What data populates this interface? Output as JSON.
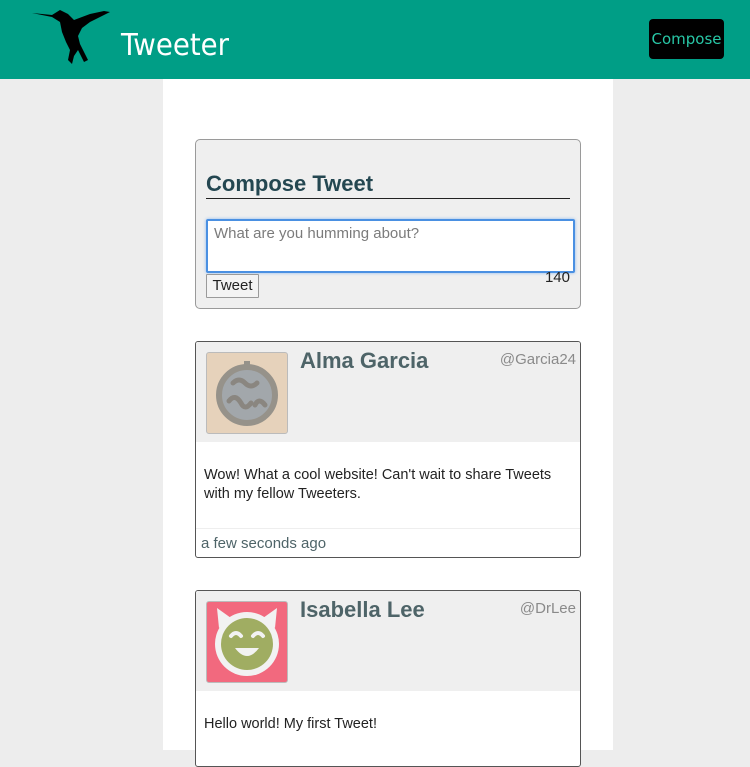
{
  "navbar": {
    "logo_icon": "hummingbird-icon",
    "brand": "Tweeter",
    "compose_button": "Compose",
    "colors": {
      "background": "#009e86",
      "compose_text": "#28c7a6"
    }
  },
  "composer": {
    "title": "Compose Tweet",
    "placeholder": "What are you humming about?",
    "value": "",
    "submit_label": "Tweet",
    "counter": "140"
  },
  "tweets": [
    {
      "name": "Alma Garcia",
      "handle": "@Garcia24",
      "avatar_icon": "smiley-face-icon",
      "avatar_bg": "#e6d2bb",
      "body": "Wow! What a cool website! Can't wait to share Tweets with my fellow Tweeters.",
      "time": "a few seconds ago"
    },
    {
      "name": "Isabella Lee",
      "handle": "@DrLee",
      "avatar_icon": "devil-face-icon",
      "avatar_bg": "#f2697e",
      "body": "Hello world! My first Tweet!",
      "time": ""
    }
  ]
}
